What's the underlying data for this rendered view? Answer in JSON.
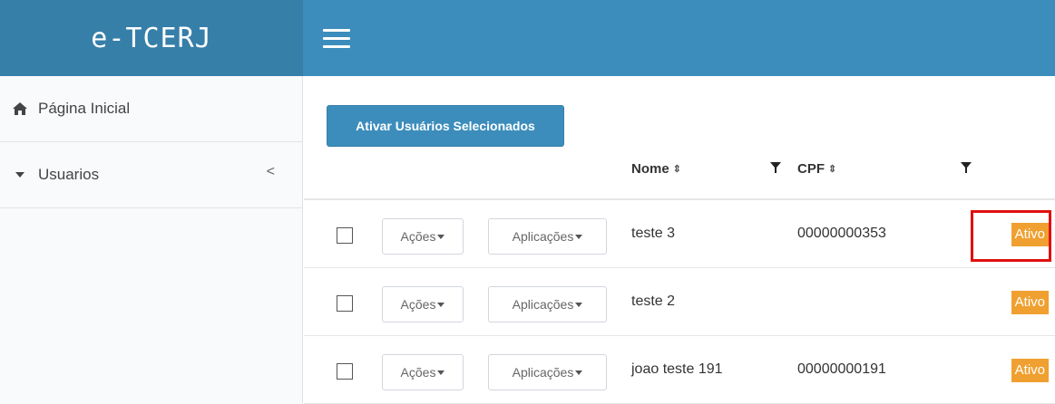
{
  "app": {
    "brand": "e-TCERJ"
  },
  "sidebar": {
    "items": [
      {
        "label": "Página Inicial",
        "icon": "home-icon"
      },
      {
        "label": "Usuarios",
        "icon": "caret-down-icon",
        "chevron": "<"
      }
    ]
  },
  "toolbar": {
    "activate_label": "Ativar Usuários Selecionados"
  },
  "table": {
    "columns": [
      {
        "label": "Nome",
        "sort": "⇕"
      },
      {
        "label": "CPF",
        "sort": "⇕"
      }
    ],
    "rows": [
      {
        "acoes": "Ações",
        "aplicacoes": "Aplicações",
        "nome": "teste 3",
        "cpf": "00000000353",
        "status": "Ativo"
      },
      {
        "acoes": "Ações",
        "aplicacoes": "Aplicações",
        "nome": "teste 2",
        "cpf": "",
        "status": "Ativo"
      },
      {
        "acoes": "Ações",
        "aplicacoes": "Aplicações",
        "nome": "joao teste 191",
        "cpf": "00000000191",
        "status": "Ativo"
      }
    ]
  },
  "colors": {
    "header": "#3c8dbc",
    "brand_bg": "#367fa9",
    "badge": "#f0a030",
    "highlight": "#e01010"
  }
}
